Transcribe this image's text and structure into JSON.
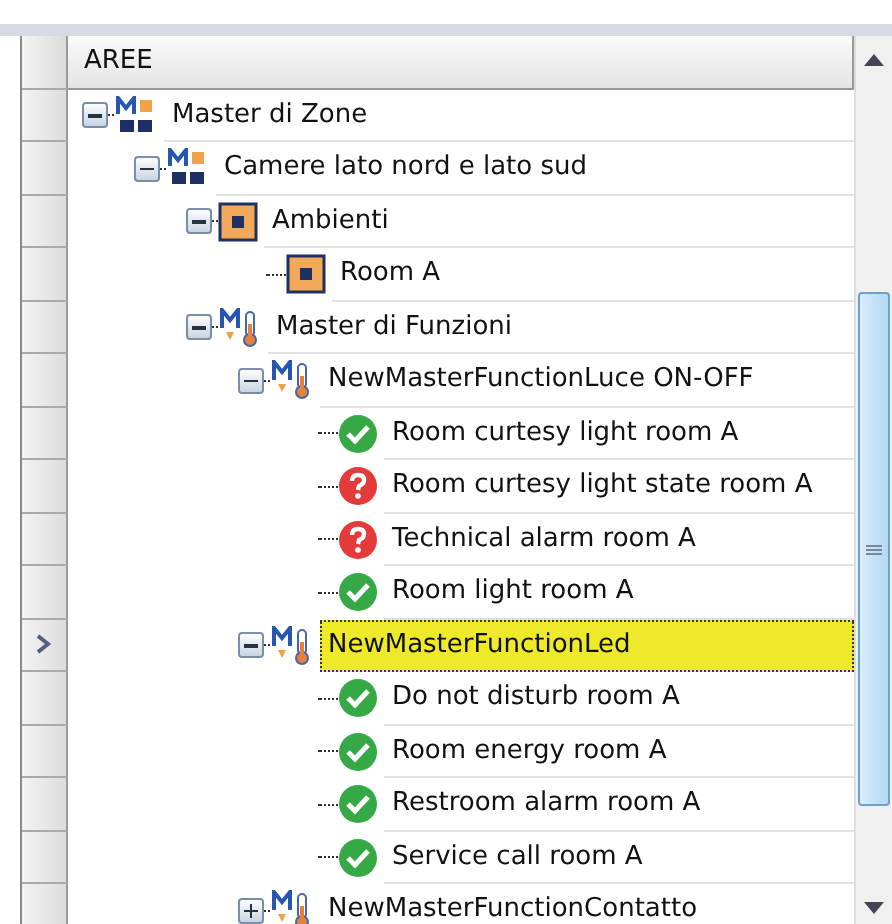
{
  "tree": {
    "column_header": "AREE",
    "nodes": [
      {
        "label": "Master di Zone",
        "kind": "zone-master",
        "expanded": true,
        "selected": false,
        "children": [
          {
            "label": "Camere lato nord e lato sud",
            "kind": "zone-master",
            "expanded": true,
            "selected": false,
            "children": [
              {
                "label": "Ambienti",
                "kind": "area",
                "expanded": true,
                "selected": false,
                "children": [
                  {
                    "label": "Room A",
                    "kind": "area",
                    "selected": false
                  }
                ]
              },
              {
                "label": "Master di Funzioni",
                "kind": "function-master",
                "expanded": true,
                "selected": false,
                "children": [
                  {
                    "label": "NewMasterFunctionLuce ON-OFF",
                    "kind": "function-master",
                    "expanded": true,
                    "selected": false,
                    "children": [
                      {
                        "label": "Room curtesy light room A",
                        "kind": "ok",
                        "selected": false
                      },
                      {
                        "label": "Room curtesy light state room A",
                        "kind": "unknown",
                        "selected": false
                      },
                      {
                        "label": "Technical alarm room A",
                        "kind": "unknown",
                        "selected": false
                      },
                      {
                        "label": "Room light room A",
                        "kind": "ok",
                        "selected": false
                      }
                    ]
                  },
                  {
                    "label": "NewMasterFunctionLed",
                    "kind": "function-master",
                    "expanded": true,
                    "selected": true,
                    "children": [
                      {
                        "label": "Do not disturb room A",
                        "kind": "ok",
                        "selected": false
                      },
                      {
                        "label": "Room energy room A",
                        "kind": "ok",
                        "selected": false
                      },
                      {
                        "label": "Restroom alarm room A",
                        "kind": "ok",
                        "selected": false
                      },
                      {
                        "label": "Service call room A",
                        "kind": "ok",
                        "selected": false
                      }
                    ]
                  },
                  {
                    "label": "NewMasterFunctionContatto",
                    "kind": "function-master",
                    "expanded": false,
                    "selected": false
                  }
                ]
              }
            ]
          }
        ]
      }
    ]
  }
}
